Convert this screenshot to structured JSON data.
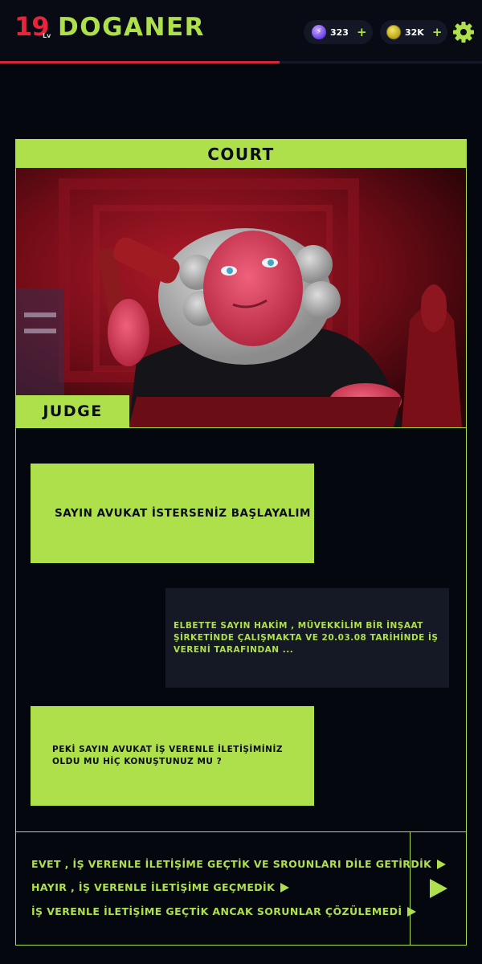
{
  "player": {
    "level": "19",
    "level_suffix": "Lv",
    "name": "DOGANER",
    "xp_progress_fraction": 0.58
  },
  "currencies": [
    {
      "name": "gems",
      "icon": "lightning-gem-icon",
      "value": "323",
      "add": "+"
    },
    {
      "name": "coins",
      "icon": "coin-icon",
      "value": "32K",
      "add": "+"
    }
  ],
  "settings_icon": "gear-icon",
  "court": {
    "title": "COURT",
    "speaker": "JUDGE",
    "dialogue": [
      {
        "from": "judge",
        "text": "SAYIN AVUKAT İSTERSENİZ BAŞLAYALIM"
      },
      {
        "from": "player",
        "text": "ELBETTE SAYIN HAKİM , MÜVEKKİLİM BİR İNŞAAT ŞİRKETİNDE ÇALIŞMAKTA VE 20.03.08 TARİHİNDE İŞ VERENİ TARAFINDAN ..."
      },
      {
        "from": "judge",
        "text": "PEKİ SAYIN AVUKAT İŞ VERENLE İLETİŞİMİNİZ OLDU MU HİÇ KONUŞTUNUZ MU ?"
      }
    ],
    "choices": [
      "EVET , İŞ VERENLE İLETİŞİME GEÇTİK VE SROUNLARI DİLE GETİRDİK",
      "HAYIR , İŞ VERENLE İLETİŞİME GEÇMEDİK",
      "İŞ VERENLE İLETİŞİME GEÇTİK ANCAK SORUNLAR ÇÖZÜLEMEDİ"
    ],
    "next_icon": "play-icon"
  },
  "colors": {
    "accent": "#aee04b",
    "level": "#e8243c",
    "progress": "#d4253a",
    "background": "#05070f",
    "player_bubble": "#151825"
  }
}
